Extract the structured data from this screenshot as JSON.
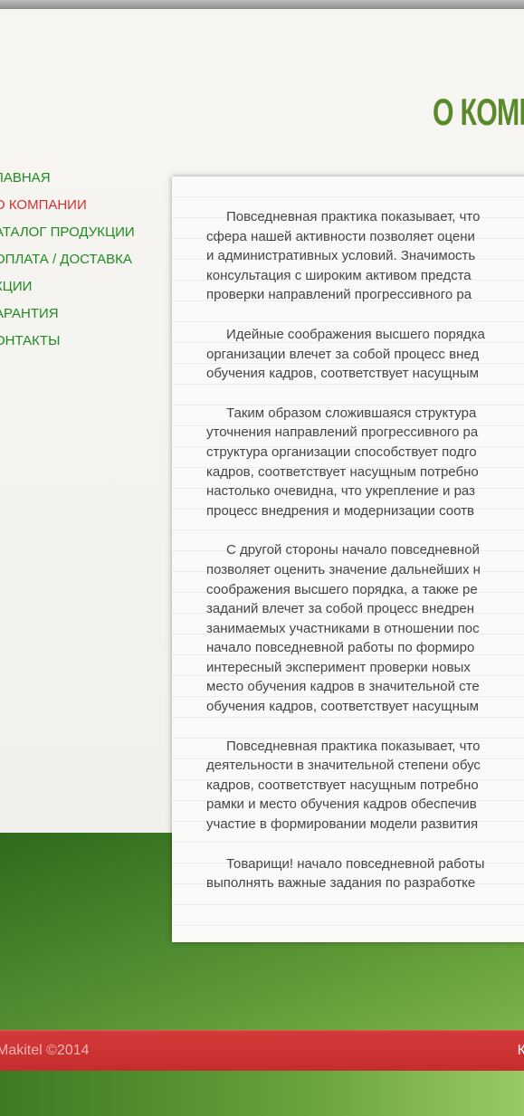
{
  "page_title": "О КОМП",
  "nav": {
    "items": [
      {
        "label": "ЛАВНАЯ",
        "active": false
      },
      {
        "label": "О КОМПАНИИ",
        "active": true
      },
      {
        "label": "АТАЛОГ ПРОДУКЦИИ",
        "active": false
      },
      {
        "label": "ОПЛАТА / ДОСТАВКА",
        "active": false
      },
      {
        "label": "КЦИИ",
        "active": false
      },
      {
        "label": "АРАНТИЯ",
        "active": false
      },
      {
        "label": "ОНТАКТЫ",
        "active": false
      }
    ]
  },
  "content": {
    "paragraphs": [
      "Повседневная практика показывает, что\nсфера нашей активности позволяет оцени\nи административных условий. Значимость\nконсультация с широким активом предста\nпроверки направлений прогрессивного ра",
      "Идейные соображения высшего порядка\nорганизации влечет за собой процесс внед\nобучения кадров, соответствует насущным",
      "Таким образом сложившаяся структура\nуточнения направлений прогрессивного ра\nструктура организации способствует подго\nкадров, соответствует насущным потребно\nнастолько очевидна, что укрепление и раз\nпроцесс внедрения и модернизации соотв",
      "С другой стороны начало повседневной\nпозволяет оценить значение дальнейших н\nсоображения высшего порядка, а также ре\nзаданий влечет за собой процесс внедрен\nзанимаемых участниками в отношении пос\nначало повседневной работы по формиро\nинтересный эксперимент проверки новых\nместо обучения кадров в значительной сте\nобучения кадров, соответствует насущным",
      "Повседневная практика показывает, что\nдеятельности в значительной степени обус\nкадров, соответствует насущным потребно\nрамки и место обучения кадров обеспечив\nучастие в формировании модели развития",
      "Товарищи! начало повседневной работы\nвыполнять важные задания по разработке"
    ]
  },
  "footer": {
    "copyright": "Makitel ©2014",
    "right_text": "К"
  },
  "colors": {
    "accent_green": "#5a8a2c",
    "nav_green": "#1f8a1f",
    "nav_active": "#d43030",
    "footer_red": "#c42d2d"
  }
}
